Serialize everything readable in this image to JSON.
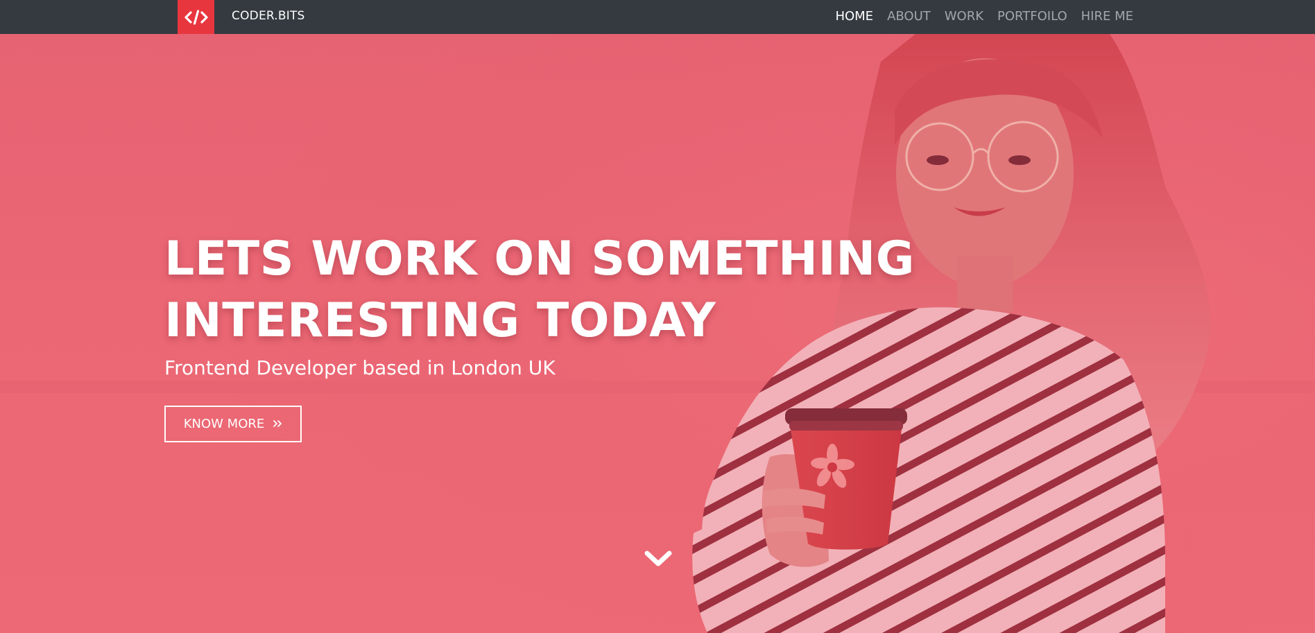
{
  "brand": {
    "name": "CODER.BITS",
    "logo_icon": "code-brackets-icon",
    "accent_color": "#e8363f"
  },
  "nav": {
    "items": [
      {
        "label": "HOME",
        "active": true
      },
      {
        "label": "ABOUT",
        "active": false
      },
      {
        "label": "WORK",
        "active": false
      },
      {
        "label": "PORTFOILO",
        "active": false
      },
      {
        "label": "HIRE ME",
        "active": false
      }
    ],
    "background_color": "#343a40"
  },
  "hero": {
    "title_line1": "LETS WORK ON SOMETHING",
    "title_line2": "INTERESTING TODAY",
    "subtitle": "Frontend Developer based in London UK",
    "cta_label": "KNOW MORE",
    "cta_icon": "double-chevron-right-icon",
    "scroll_icon": "chevron-down-icon",
    "overlay_color": "#e85c6a"
  }
}
